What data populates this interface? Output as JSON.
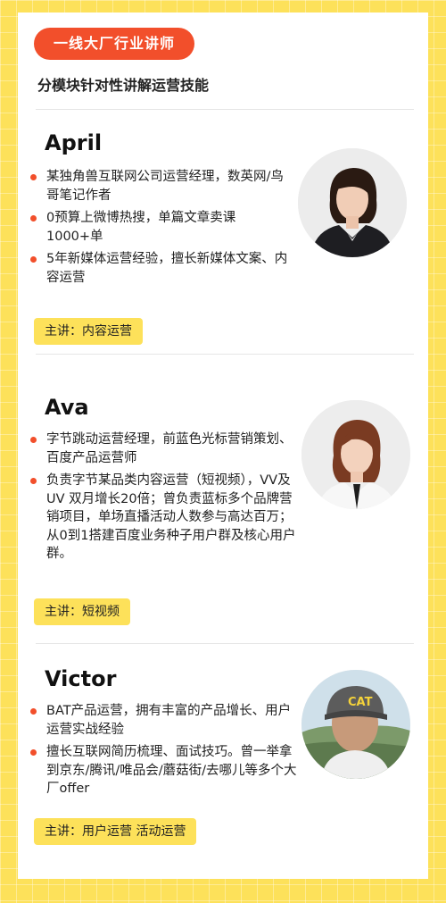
{
  "header": {
    "badge": "一线大厂行业讲师",
    "subtitle": "分模块针对性讲解运营技能"
  },
  "instructors": [
    {
      "name": "April",
      "bullets": [
        "某独角兽互联网公司运营经理，数英网/鸟哥笔记作者",
        "0预算上微博热搜，单篇文章卖课1000+单",
        "5年新媒体运营经验，擅长新媒体文案、内容运营"
      ],
      "topic": "主讲：内容运营",
      "avatar_icon": "woman-portrait-icon"
    },
    {
      "name": "Ava",
      "bullets": [
        "字节跳动运营经理，前蓝色光标营销策划、百度产品运营师",
        "负责字节某品类内容运营（短视频），VV及UV 双月增长20倍；曾负责蓝标多个品牌营销项目，单场直播活动人数参与高达百万；从0到1搭建百度业务种子用户群及核心用户群。"
      ],
      "topic": "主讲：短视频",
      "avatar_icon": "woman-portrait-icon"
    },
    {
      "name": "Victor",
      "bullets": [
        "BAT产品运营，拥有丰富的产品增长、用户运营实战经验",
        "擅长互联网简历梳理、面试技巧。曾一举拿到京东/腾讯/唯品会/蘑菇街/去哪儿等多个大厂offer"
      ],
      "topic": "主讲：用户运营 活动运营",
      "avatar_icon": "man-cap-portrait-icon",
      "cap_text": "CAT"
    }
  ],
  "colors": {
    "background": "#fde15a",
    "accent": "#f24f2b",
    "tag": "#fde15a"
  }
}
